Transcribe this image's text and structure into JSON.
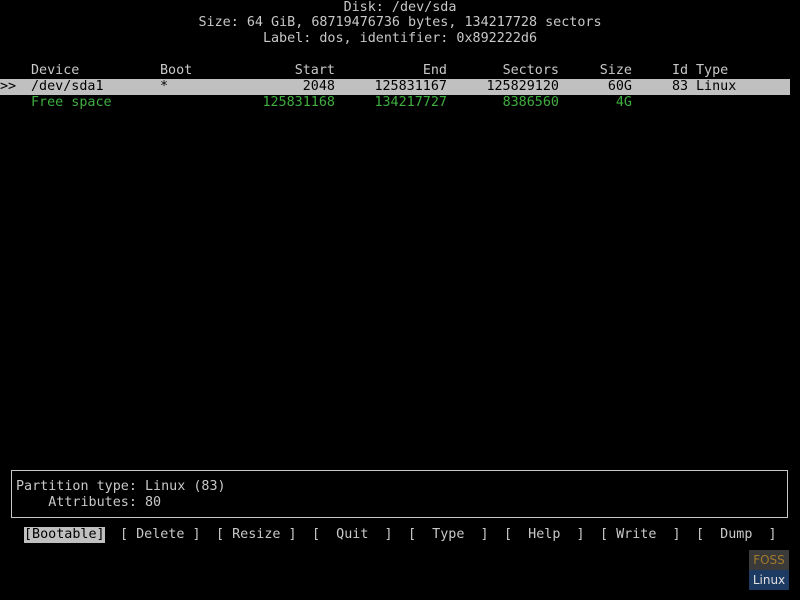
{
  "disk": {
    "title": "Disk: /dev/sda",
    "size_line": "Size: 64 GiB, 68719476736 bytes, 134217728 sectors",
    "label_line": "Label: dos, identifier: 0x892222d6"
  },
  "table": {
    "headers": {
      "device": "Device",
      "boot": "Boot",
      "start": "Start",
      "end": "End",
      "sectors": "Sectors",
      "size": "Size",
      "id": "Id",
      "type": "Type"
    },
    "rows": [
      {
        "marker": ">>",
        "device": "/dev/sda1",
        "boot": "*",
        "start": "2048",
        "end": "125831167",
        "sectors": "125829120",
        "size": "60G",
        "id": "83",
        "type": "Linux"
      },
      {
        "marker": "",
        "device": "Free space",
        "boot": "",
        "start": "125831168",
        "end": "134217727",
        "sectors": "8386560",
        "size": "4G",
        "id": "",
        "type": ""
      }
    ]
  },
  "info": {
    "partition_type": "Partition type: Linux (83)",
    "attributes": "    Attributes: 80"
  },
  "menu": {
    "bootable": "[Bootable]",
    "delete": "[ Delete ]",
    "resize": "[ Resize ]",
    "quit": "[  Quit  ]",
    "type": "[  Type  ]",
    "help": "[  Help  ]",
    "write": "[ Write  ]",
    "dump": "[  Dump  ]"
  },
  "logo": {
    "top": "FOSS",
    "bottom": "Linux"
  },
  "colors": {
    "background": "#000000",
    "text": "#c8c8c8",
    "selected_bg": "#c0c0c0",
    "free_space": "#3fae3f"
  }
}
